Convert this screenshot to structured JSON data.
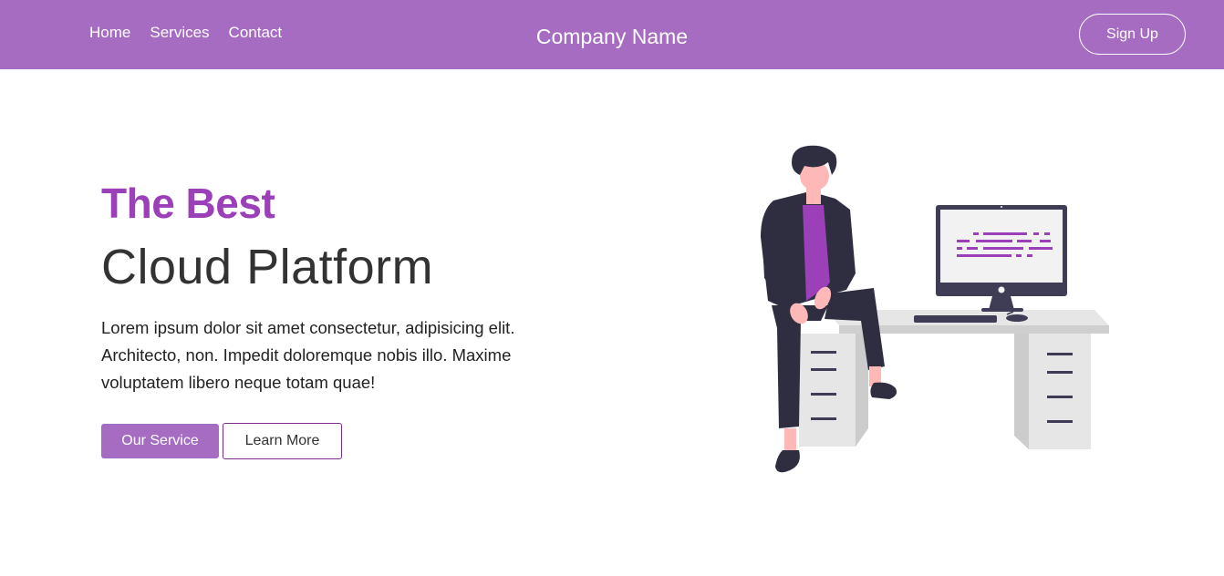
{
  "colors": {
    "brand": "#a56cc1",
    "accent": "#9b40b8",
    "heading": "#333333",
    "outline_border": "#7b2d8b"
  },
  "navbar": {
    "links": [
      "Home",
      "Services",
      "Contact"
    ],
    "brand": "Company Name",
    "signup_label": "Sign Up"
  },
  "hero": {
    "subtitle": "The Best",
    "title": "Cloud Platform",
    "text": "Lorem ipsum dolor sit amet consectetur, adipisicing elit. Architecto, non. Impedit doloremque nobis illo. Maxime voluptatem libero neque totam quae!",
    "primary_button": "Our Service",
    "secondary_button": "Learn More"
  },
  "illustration": {
    "icons": [
      "person-icon",
      "desk-icon",
      "monitor-icon",
      "keyboard-icon",
      "mouse-icon"
    ]
  }
}
